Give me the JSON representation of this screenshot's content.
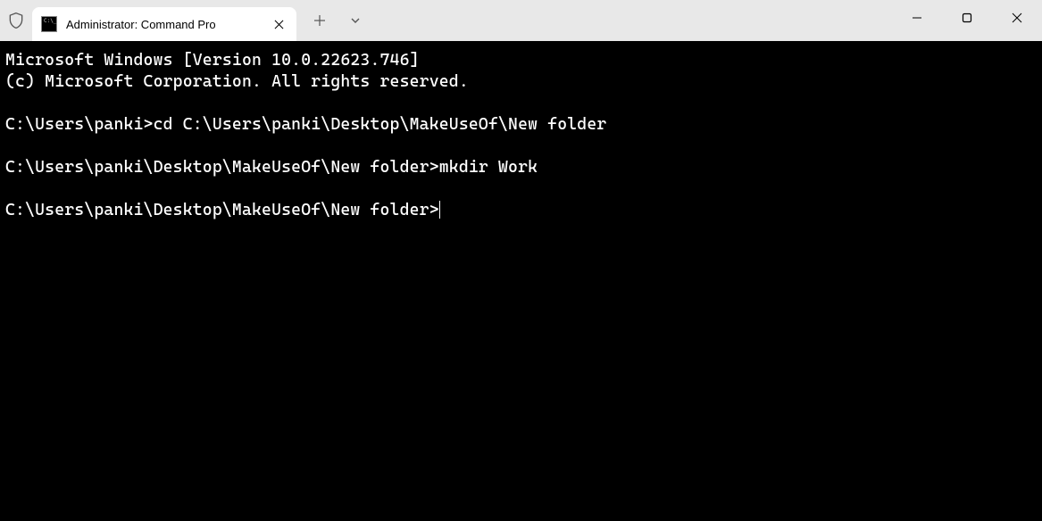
{
  "titlebar": {
    "tab_title": "Administrator: Command Pro"
  },
  "terminal": {
    "lines": [
      "Microsoft Windows [Version 10.0.22623.746]",
      "(c) Microsoft Corporation. All rights reserved.",
      "",
      "C:\\Users\\panki>cd C:\\Users\\panki\\Desktop\\MakeUseOf\\New folder",
      "",
      "C:\\Users\\panki\\Desktop\\MakeUseOf\\New folder>mkdir Work",
      "",
      "C:\\Users\\panki\\Desktop\\MakeUseOf\\New folder>"
    ],
    "cursor_on_last_line": true
  }
}
